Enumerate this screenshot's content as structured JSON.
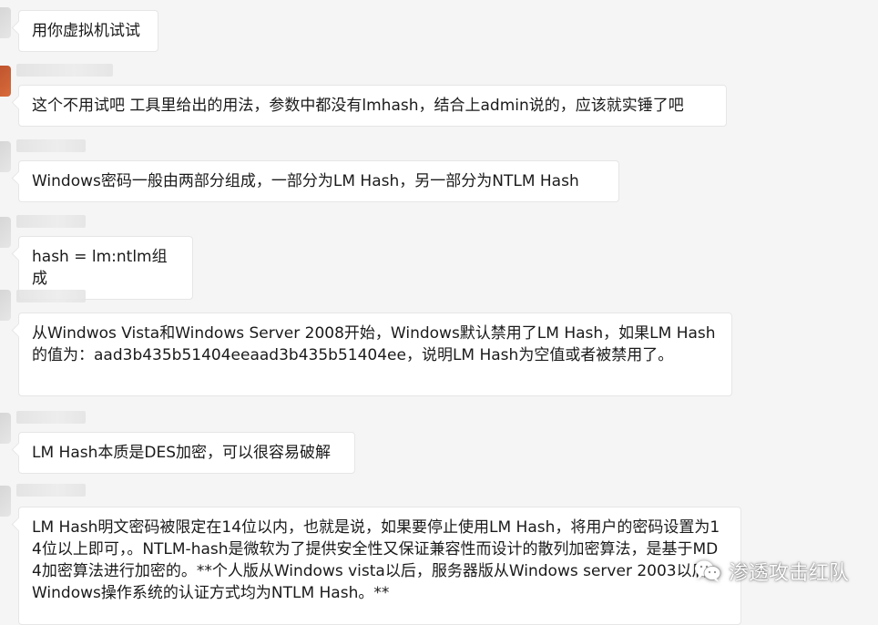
{
  "messages": [
    {
      "text": "用你虚拟机试试"
    },
    {
      "text": "这个不用试吧 工具里给出的用法，参数中都没有lmhash，结合上admin说的，应该就实锤了吧"
    },
    {
      "text": "Windows密码一般由两部分组成，一部分为LM Hash，另一部分为NTLM Hash"
    },
    {
      "text": "hash = lm:ntlm组成"
    },
    {
      "text": "从Windwos Vista和Windows Server 2008开始，Windows默认禁用了LM Hash，如果LM Hash的值为：aad3b435b51404eeaad3b435b51404ee，说明LM Hash为空值或者被禁用了。"
    },
    {
      "text": "LM Hash本质是DES加密，可以很容易破解"
    },
    {
      "text": "LM Hash明文密码被限定在14位以内，也就是说，如果要停止使用LM Hash，将用户的密码设置为14位以上即可，。NTLM-hash是微软为了提供安全性又保证兼容性而设计的散列加密算法，是基于MD4加密算法进行加密的。**个人版从Windows vista以后，服务器版从Windows server 2003以后，Windows操作系统的认证方式均为NTLM Hash。**"
    }
  ],
  "watermark": {
    "icon": "wechat-icon",
    "text": "渗透攻击红队"
  }
}
